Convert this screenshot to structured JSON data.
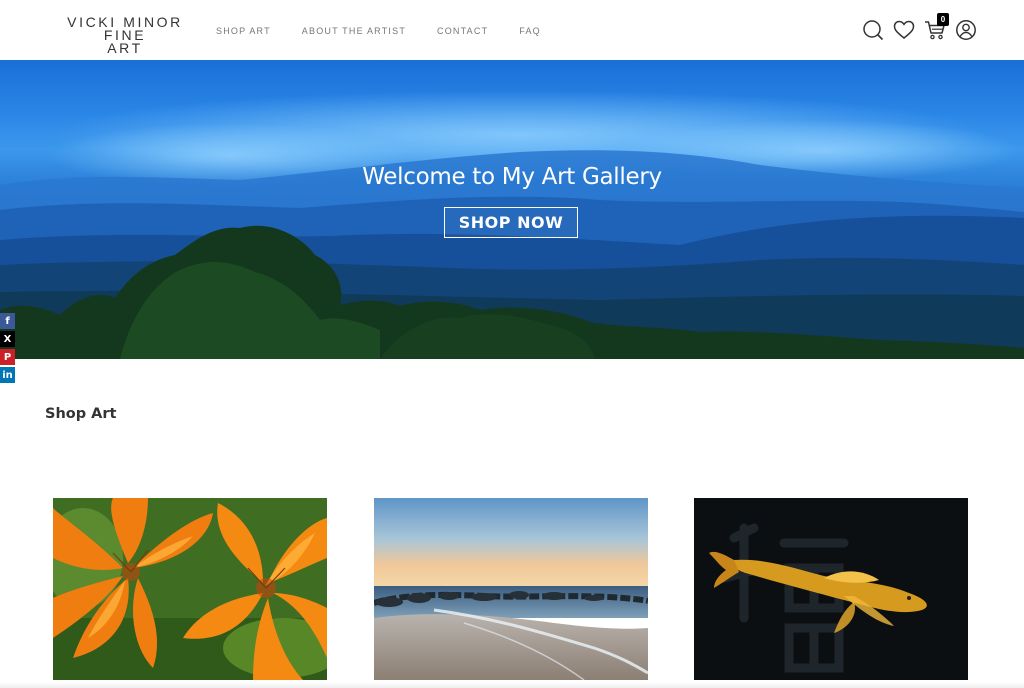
{
  "header": {
    "logo_line1": "VICKI MINOR FINE",
    "logo_line2": "ART",
    "nav": [
      {
        "label": "SHOP ART"
      },
      {
        "label": "ABOUT THE ARTIST"
      },
      {
        "label": "CONTACT"
      },
      {
        "label": "FAQ"
      }
    ],
    "cart_count": "0",
    "icons": [
      "search-icon",
      "heart-icon",
      "cart-icon",
      "account-icon"
    ]
  },
  "hero": {
    "title": "Welcome to My Art Gallery",
    "button_label": "SHOP NOW"
  },
  "social": [
    {
      "icon": "facebook-icon",
      "glyph": "f",
      "color": "#3b5998"
    },
    {
      "icon": "x-icon",
      "glyph": "X",
      "color": "#000000"
    },
    {
      "icon": "pinterest-icon",
      "glyph": "P",
      "color": "#cb2027"
    },
    {
      "icon": "linkedin-icon",
      "glyph": "in",
      "color": "#0077b5"
    }
  ],
  "shop": {
    "title": "Shop Art"
  }
}
